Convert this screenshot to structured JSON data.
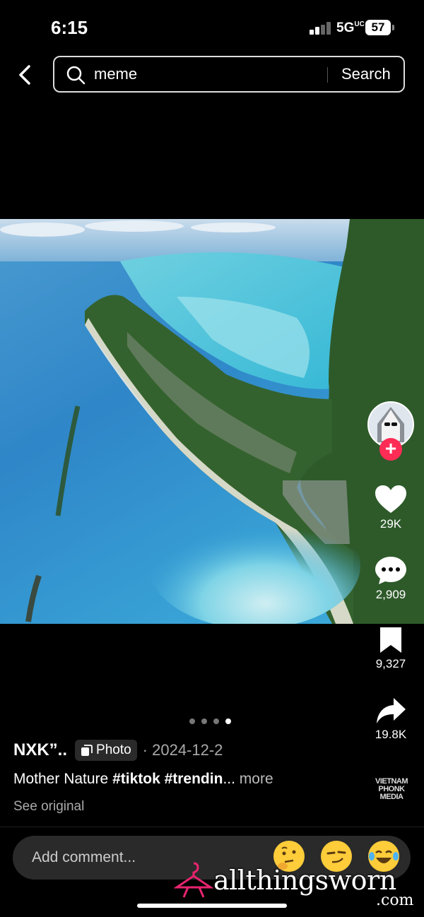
{
  "status_bar": {
    "time": "6:15",
    "network": "5G",
    "network_sup": "UC",
    "battery": "57"
  },
  "search": {
    "query": "meme",
    "button_label": "Search"
  },
  "post": {
    "author": "NXK”..",
    "type_badge": "Photo",
    "date": "· 2024-12-2",
    "caption_text": "Mother Nature ",
    "caption_tags": "#tiktok #trendin",
    "caption_ellipsis": "...",
    "caption_more": " more",
    "see_original": "See original",
    "carousel": {
      "count": 4,
      "active_index": 4
    }
  },
  "actions": {
    "likes": "29K",
    "comments": "2,909",
    "saves": "9,327",
    "shares": "19.8K"
  },
  "sound_watermark": "VIETNAM PHONK MEDIA",
  "comment_bar": {
    "placeholder": "Add comment...",
    "emojis": [
      "thinking-face",
      "smirking-face",
      "tears-of-joy-face"
    ]
  },
  "site_watermark": {
    "brand": "allthingsworn",
    "suffix": ".com"
  },
  "colors": {
    "follow": "#ff2c55",
    "background": "#000000",
    "emoji": "#ffcc3a"
  }
}
